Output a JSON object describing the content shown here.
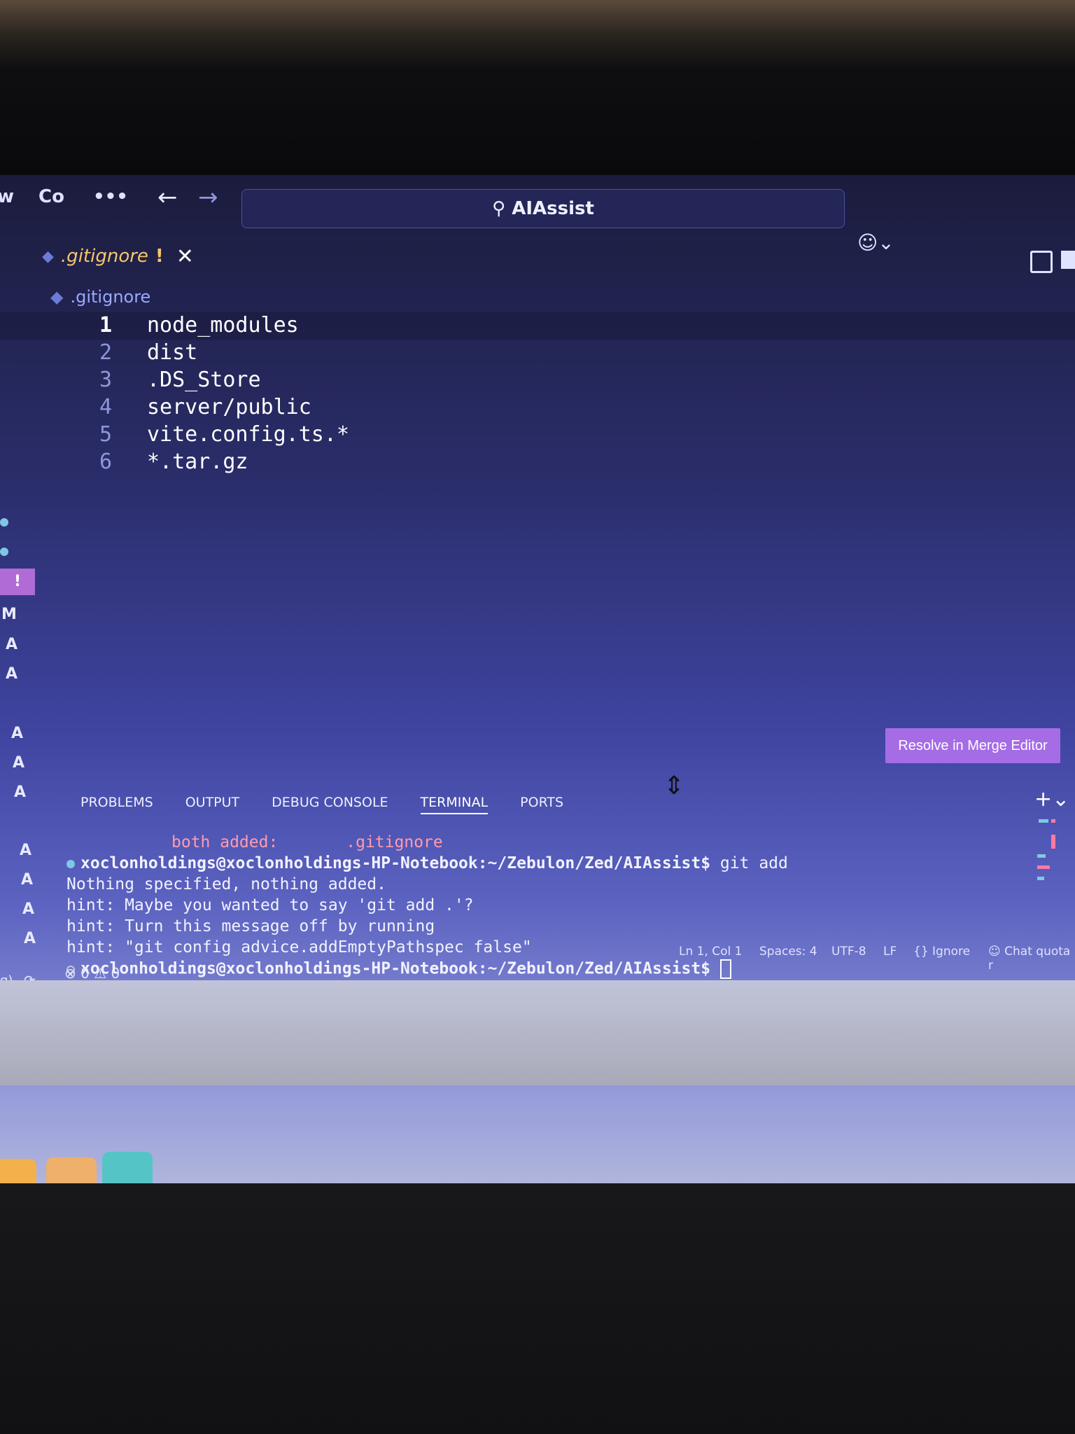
{
  "titlebar": {
    "menu_items": [
      "w",
      "Co",
      "•••"
    ],
    "back_arrow": "←",
    "forward_arrow": "→",
    "command_center": "AIAssist",
    "copilot_icon": "copilot-icon",
    "layout_icon": "layout-icon"
  },
  "tab": {
    "name": ".gitignore",
    "badge": "!",
    "close": "✕"
  },
  "breadcrumb": {
    "file": ".gitignore"
  },
  "editor": {
    "lines": [
      {
        "n": "1",
        "text": "node_modules"
      },
      {
        "n": "2",
        "text": "dist"
      },
      {
        "n": "3",
        "text": ".DS_Store"
      },
      {
        "n": "4",
        "text": "server/public"
      },
      {
        "n": "5",
        "text": "vite.config.ts.*"
      },
      {
        "n": "6",
        "text": "*.tar.gz"
      }
    ]
  },
  "scm_gutter": {
    "warning": "!",
    "markers": [
      "M",
      "A",
      "A",
      "A",
      "A",
      "A",
      "A",
      "A",
      "A",
      "A"
    ]
  },
  "merge_button": "Resolve in Merge Editor",
  "panel": {
    "tabs": [
      "PROBLEMS",
      "OUTPUT",
      "DEBUG CONSOLE",
      "TERMINAL",
      "PORTS"
    ],
    "active_tab": "TERMINAL",
    "add": "+⌄"
  },
  "terminal": {
    "conflict_label": "both added:",
    "conflict_file": ".gitignore",
    "prompt1": "xoclonholdings@xoclonholdings-HP-Notebook:~/Zebulon/Zed/AIAssist$",
    "command1": " git add",
    "output": [
      "Nothing specified, nothing added.",
      "hint: Maybe you wanted to say 'git add .'?",
      "hint: Turn this message off by running",
      "hint: \"git config advice.addEmptyPathspec false\""
    ],
    "prompt2": "xoclonholdings@xoclonholdings-HP-Notebook:~/Zebulon/Zed/AIAssist$",
    "prompt_dot_active": "#7ec8e3",
    "prompt_dot_idle": "#c8c8d8"
  },
  "statusbar": {
    "errors": "0",
    "warnings": "0",
    "position": "Ln 1, Col 1",
    "spaces": "Spaces: 4",
    "encoding": "UTF-8",
    "eol": "LF",
    "language": "{} Ignore",
    "chat": "Chat quota r",
    "branch_fragment": "g)"
  },
  "colors": {
    "accent": "#a56ce6",
    "tab_modified": "#f7c56b",
    "conflict": "#ff9bb0"
  }
}
